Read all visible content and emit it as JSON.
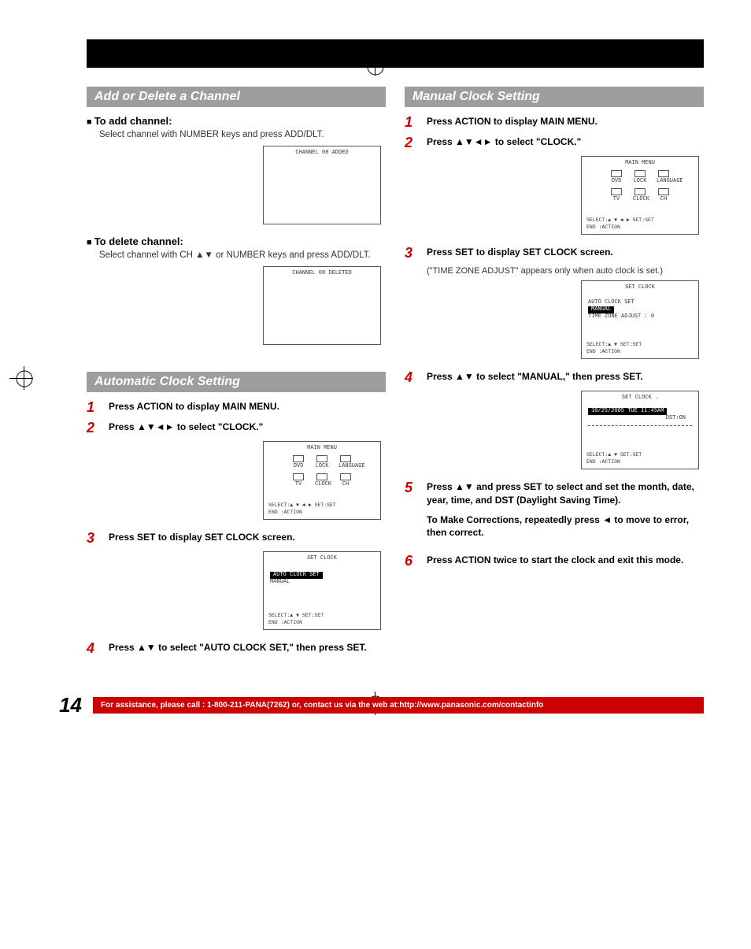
{
  "sections": {
    "add_delete": {
      "title": "Add or Delete a Channel",
      "add_head": "To add channel:",
      "add_text": "Select channel with NUMBER keys and press ADD/DLT.",
      "del_head": "To delete channel:",
      "del_text": "Select channel with CH ▲▼ or NUMBER keys and press ADD/DLT."
    },
    "auto_clock": {
      "title": "Automatic Clock Setting",
      "steps": {
        "s1": "Press ACTION to display MAIN MENU.",
        "s2": "Press ▲▼◄► to select \"CLOCK.\"",
        "s3": "Press SET to display SET CLOCK screen.",
        "s4": "Press ▲▼ to select \"AUTO CLOCK SET,\" then press SET."
      }
    },
    "manual_clock": {
      "title": "Manual Clock Setting",
      "steps": {
        "s1": "Press ACTION to display MAIN MENU.",
        "s2": "Press ▲▼◄► to select \"CLOCK.\"",
        "s3": "Press SET to display SET CLOCK screen.",
        "s3_sub": "(\"TIME ZONE ADJUST\" appears only when auto clock is set.)",
        "s4": "Press ▲▼ to select \"MANUAL,\" then press SET.",
        "s5": "Press ▲▼ and press SET to select and set the month, date, year, time, and DST (Daylight Saving Time).",
        "s5_sub": "To Make Corrections, repeatedly press ◄ to move to error, then correct.",
        "s6": "Press ACTION twice to start the clock and exit this mode."
      }
    }
  },
  "screens": {
    "ch_added": "CHANNEL 08 ADDED",
    "ch_deleted": "CHANNEL 08 DELETED",
    "main_menu": {
      "title": "MAIN MENU",
      "row1": [
        "DVD",
        "LOCK",
        "LANGUAGE"
      ],
      "row2": [
        "TV",
        "CLOCK",
        "CH"
      ],
      "footer1": "SELECT:▲ ▼ ◄ ►   SET:SET",
      "footer2": "END   :ACTION"
    },
    "set_clock_auto": {
      "title": "SET CLOCK",
      "line1": "AUTO CLOCK SET",
      "line2": "MANUAL",
      "footer1": "SELECT:▲ ▼       SET:SET",
      "footer2": "END   :ACTION"
    },
    "set_clock_tz": {
      "title": "SET CLOCK",
      "line1": "AUTO CLOCK SET",
      "line2": "MANUAL",
      "line3": "TIME ZONE ADJUST : 0",
      "footer1": "SELECT:▲ ▼       SET:SET",
      "footer2": "END   :ACTION"
    },
    "set_clock_date": {
      "title": "SET CLOCK   .",
      "line1": "10/25/2005 TUE 11:45AM",
      "line2": "DST:ON",
      "footer1": "SELECT:▲ ▼       SET:SET",
      "footer2": "END   :ACTION"
    }
  },
  "footer": {
    "page": "14",
    "text": "For assistance, please call : 1-800-211-PANA(7262) or, contact us via the web at:http://www.panasonic.com/contactinfo"
  },
  "swatches_left": [
    "#fff",
    "#000",
    "#1a1a1a",
    "#333",
    "#4d4d4d",
    "#666",
    "#808080",
    "#999",
    "#b3b3b3",
    "#ccc"
  ],
  "swatches_right": [
    "#ff0",
    "#f0f",
    "#0ff",
    "#f00",
    "#0f0",
    "#00f",
    "#800",
    "#080",
    "#008",
    "#000"
  ]
}
